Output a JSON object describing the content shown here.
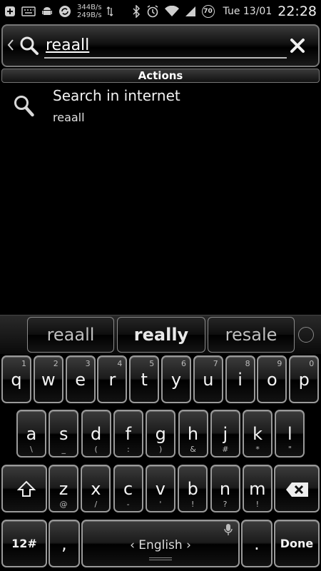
{
  "status_bar": {
    "net_up": "344B/s",
    "net_down": "249B/s",
    "battery_level": "70",
    "date": "Tue 13/01",
    "time": "22:28"
  },
  "search": {
    "query": "reaall"
  },
  "actions": {
    "header": "Actions",
    "items": [
      {
        "title": "Search in internet",
        "subtitle": "reaall"
      }
    ]
  },
  "suggestions": [
    "reaall",
    "really",
    "resale"
  ],
  "keyboard": {
    "row1": [
      {
        "k": "q",
        "h": "1"
      },
      {
        "k": "w",
        "h": "2"
      },
      {
        "k": "e",
        "h": "3"
      },
      {
        "k": "r",
        "h": "4"
      },
      {
        "k": "t",
        "h": "5"
      },
      {
        "k": "y",
        "h": "6"
      },
      {
        "k": "u",
        "h": "7"
      },
      {
        "k": "i",
        "h": "8"
      },
      {
        "k": "o",
        "h": "9"
      },
      {
        "k": "p",
        "h": "0"
      }
    ],
    "row2": [
      {
        "k": "a",
        "h": "\\"
      },
      {
        "k": "s",
        "h": "_"
      },
      {
        "k": "d",
        "h": "("
      },
      {
        "k": "f",
        "h": ":"
      },
      {
        "k": "g",
        "h": ")"
      },
      {
        "k": "h",
        "h": "&"
      },
      {
        "k": "j",
        "h": "#"
      },
      {
        "k": "k",
        "h": "*"
      },
      {
        "k": "l",
        "h": "\""
      }
    ],
    "row3": [
      {
        "k": "z",
        "h": "@"
      },
      {
        "k": "x",
        "h": "/"
      },
      {
        "k": "c",
        "h": "-"
      },
      {
        "k": "v",
        "h": "'"
      },
      {
        "k": "b",
        "h": "!"
      },
      {
        "k": "n",
        "h": "?"
      },
      {
        "k": "m",
        "h": "!"
      }
    ],
    "symbols_label": "12#",
    "comma_label": ",",
    "space_label": "English",
    "period_label": ".",
    "done_label": "Done"
  },
  "colors": {
    "background": "#000000",
    "key_border": "#9a9a9a",
    "text": "#ffffff"
  }
}
